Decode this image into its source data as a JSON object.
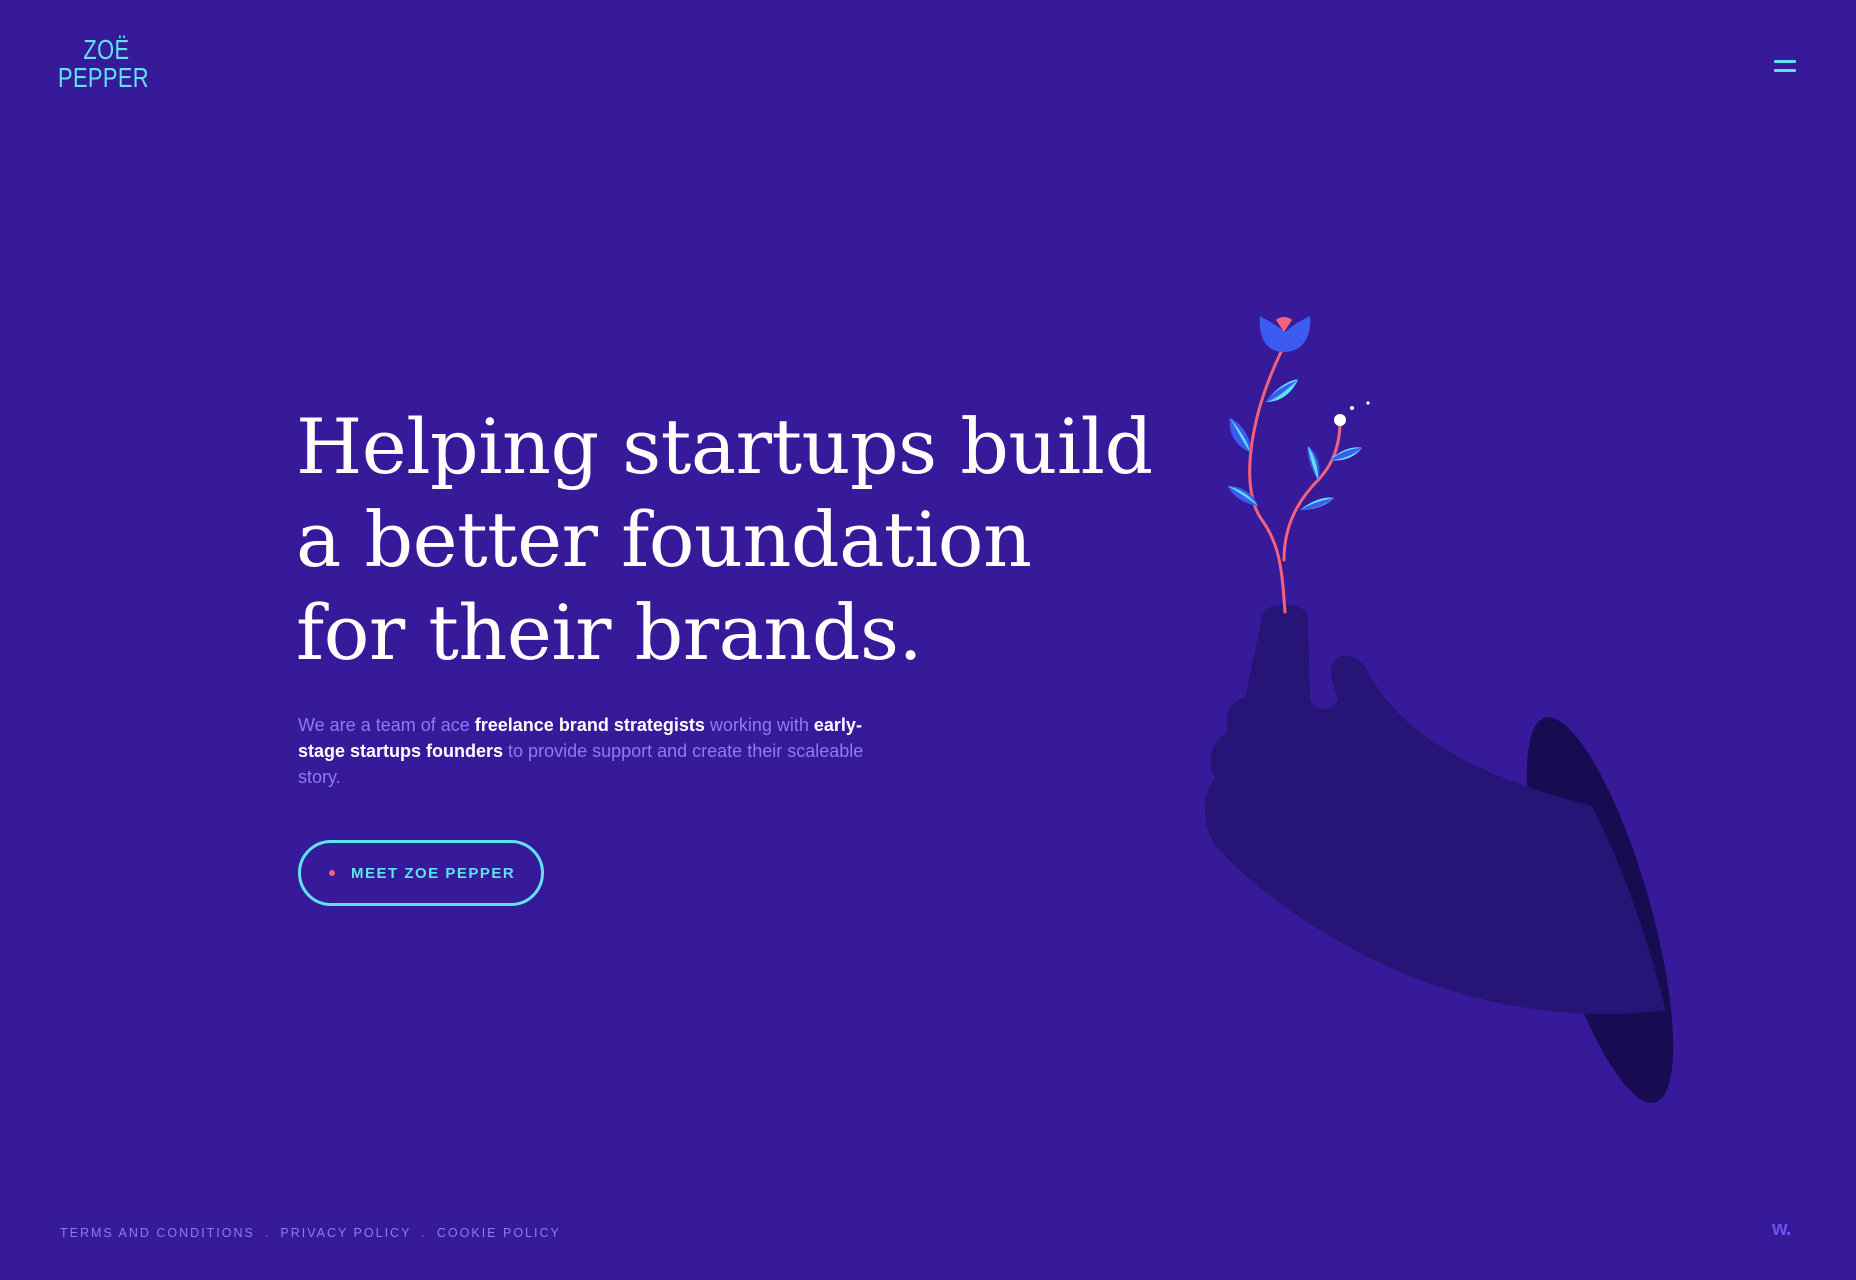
{
  "header": {
    "logo_line1": "ZOË",
    "logo_line2": "PEPPER",
    "menu_icon": "hamburger-menu-icon"
  },
  "hero": {
    "title_lines": [
      "Helping startups build",
      "a better foundation",
      "for their brands."
    ],
    "description": {
      "part1": "We are a team of ace ",
      "bold1": "freelance brand strategists",
      "part2": " working with ",
      "bold2": "early-stage startups founders",
      "part3": " to provide support and create their scaleable story."
    },
    "cta_label": "MEET ZOE PEPPER"
  },
  "illustration": {
    "icon": "hand-holding-flower-illustration"
  },
  "footer": {
    "links": [
      "TERMS AND CONDITIONS",
      "PRIVACY POLICY",
      "COOKIE POLICY"
    ],
    "separator": ".",
    "brand_mark": "w."
  },
  "colors": {
    "background": "#371a99",
    "accent_cyan": "#5fe3f2",
    "accent_pink": "#f2627d",
    "text_muted": "#8b7cf4",
    "hand_dark": "#261477",
    "sleeve_dark": "#170b52",
    "leaf_blue": "#3c5bf0"
  }
}
